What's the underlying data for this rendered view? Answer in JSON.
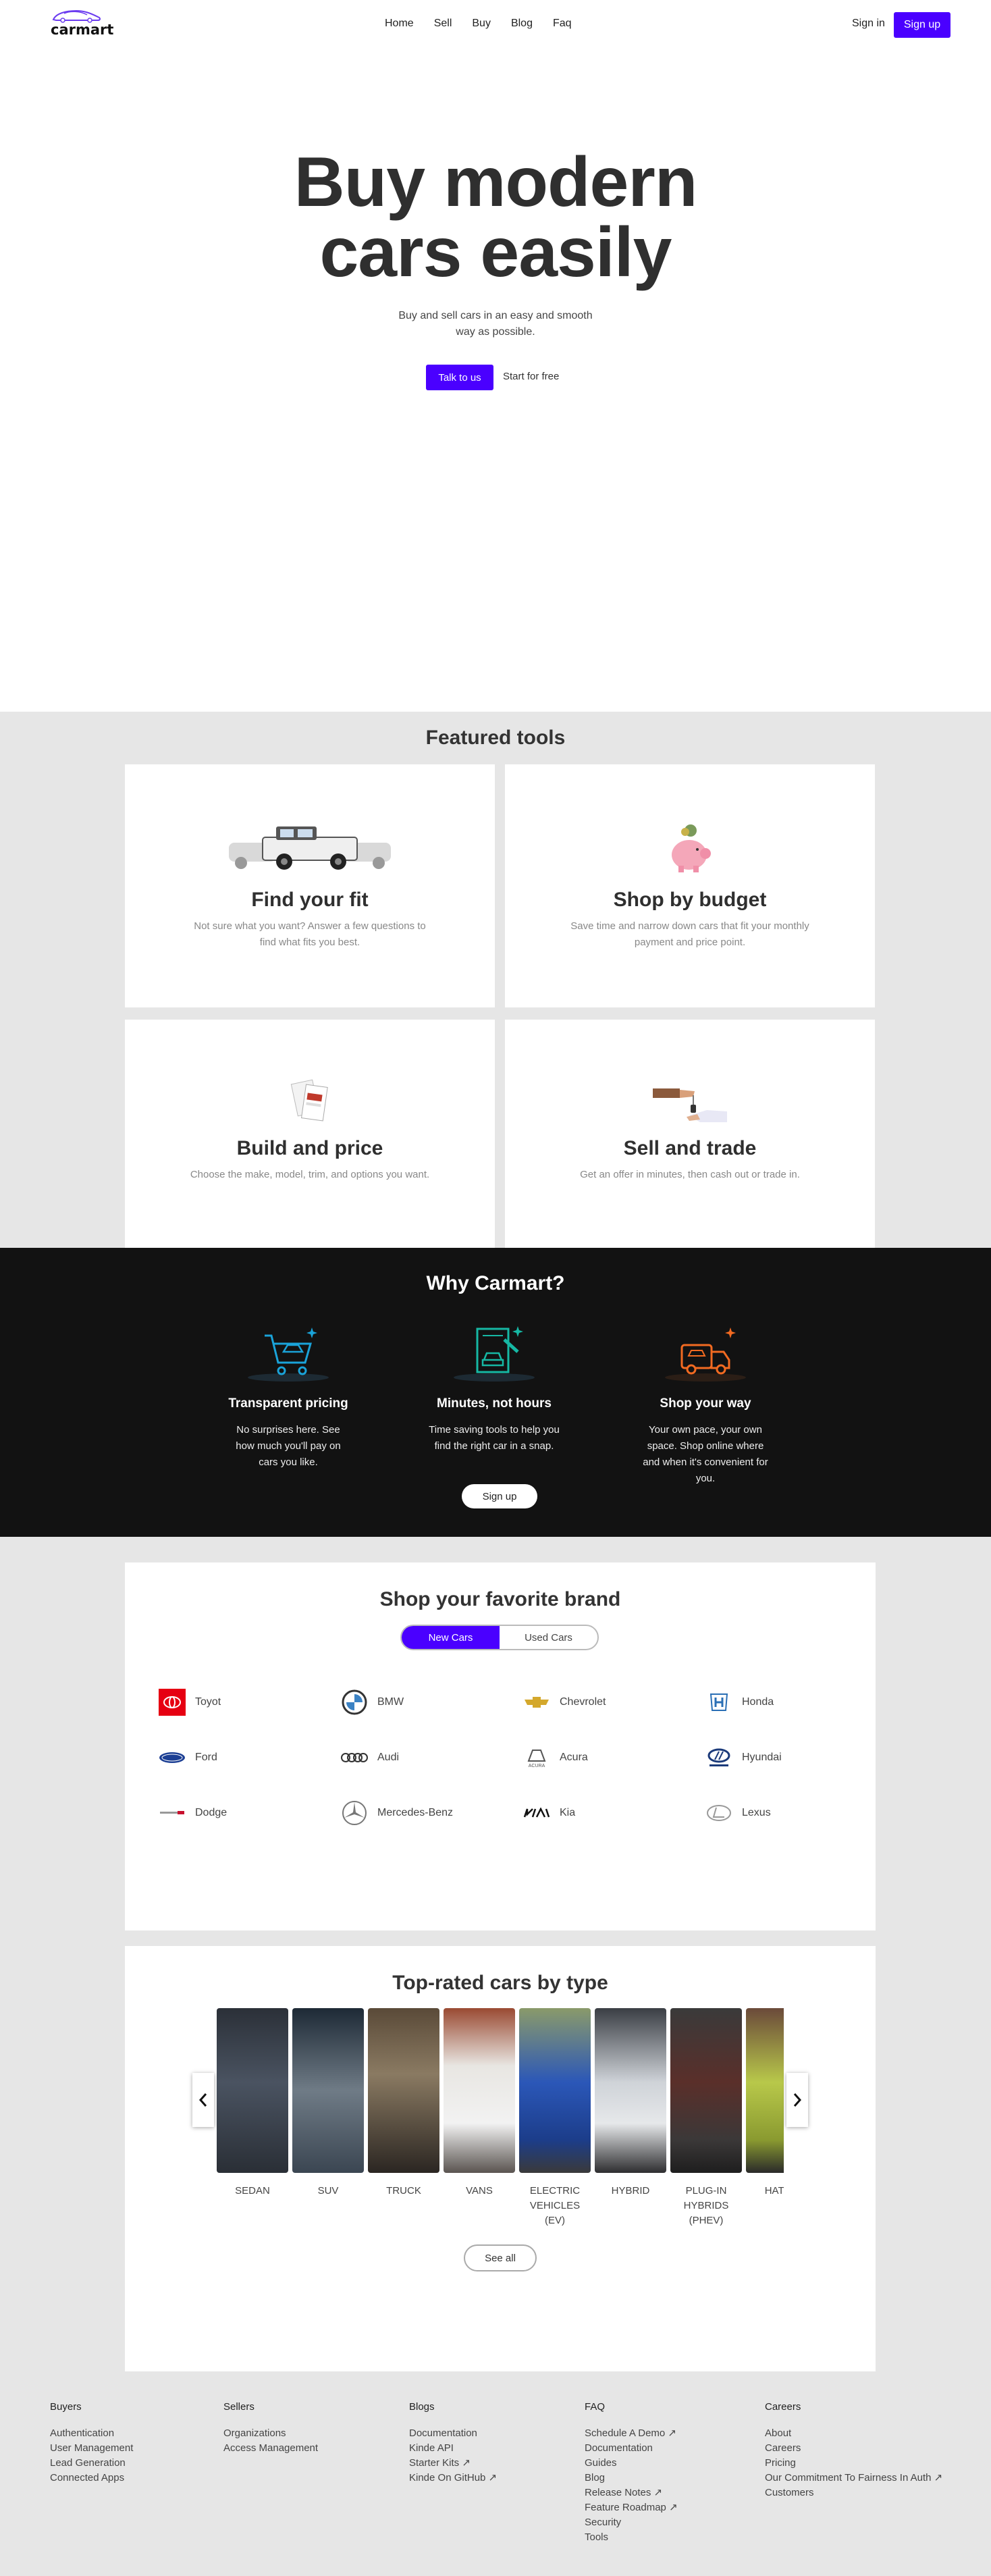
{
  "nav": {
    "brand": "carmart",
    "links": [
      "Home",
      "Sell",
      "Buy",
      "Blog",
      "Faq"
    ],
    "signin": "Sign in",
    "signup": "Sign up"
  },
  "hero": {
    "title_line1": "Buy modern",
    "title_line2": "cars easily",
    "subtitle": "Buy and sell cars in an easy and smooth way as possible.",
    "cta_primary": "Talk to us",
    "cta_secondary": "Start for free"
  },
  "featured": {
    "title": "Featured tools",
    "cards": [
      {
        "title": "Find your fit",
        "desc": "Not sure what you want? Answer a few questions to find what fits you best.",
        "image": "trucks-image"
      },
      {
        "title": "Shop by budget",
        "desc": "Save time and narrow down cars that fit your monthly payment and price point.",
        "image": "piggy-bank-image"
      },
      {
        "title": "Build and price",
        "desc": "Choose the make, model, trim, and options you want.",
        "image": "brochure-image"
      },
      {
        "title": "Sell and trade",
        "desc": "Get an offer in minutes, then cash out or trade in.",
        "image": "key-handover-image"
      }
    ]
  },
  "why": {
    "title": "Why Carmart?",
    "items": [
      {
        "title": "Transparent pricing",
        "desc": "No surprises here. See how much you'll pay on cars you like.",
        "icon": "cart-car-icon",
        "color": "#1aa3d9"
      },
      {
        "title": "Minutes, not hours",
        "desc": "Time saving tools to help you find the right car in a snap.",
        "icon": "document-car-icon",
        "color": "#16b8a4"
      },
      {
        "title": "Shop your way",
        "desc": "Your own pace, your own space. Shop online where and when it's convenient for you.",
        "icon": "delivery-truck-icon",
        "color": "#f26a21"
      }
    ],
    "signup": "Sign up"
  },
  "brands": {
    "title": "Shop your favorite brand",
    "tab_new": "New Cars",
    "tab_used": "Used Cars",
    "list": [
      "Toyot",
      "BMW",
      "Chevrolet",
      "Honda",
      "Ford",
      "Audi",
      "Acura",
      "Hyundai",
      "Dodge",
      "Mercedes-Benz",
      "Kia",
      "Lexus"
    ]
  },
  "types": {
    "title": "Top-rated cars by type",
    "items": [
      "SEDAN",
      "SUV",
      "TRUCK",
      "VANS",
      "ELECTRIC VEHICLES (EV)",
      "HYBRID",
      "PLUG-IN HYBRIDS (PHEV)",
      "HATCH"
    ],
    "see_all": "See all"
  },
  "footer": {
    "columns": [
      {
        "title": "Buyers",
        "links": [
          "Authentication",
          "User Management",
          "Lead Generation",
          "Connected Apps"
        ]
      },
      {
        "title": "Sellers",
        "links": [
          "Organizations",
          "Access Management"
        ]
      },
      {
        "title": "Blogs",
        "links": [
          "Documentation",
          "Kinde API",
          "Starter Kits ↗",
          "Kinde On GitHub ↗"
        ]
      },
      {
        "title": "FAQ",
        "links": [
          "Schedule A Demo ↗",
          "Documentation",
          "Guides",
          "Blog",
          "Release Notes ↗",
          "Feature Roadmap ↗",
          "Security",
          "Tools"
        ]
      },
      {
        "title": "Careers",
        "links": [
          "About",
          "Careers",
          "Pricing",
          "Our Commitment To Fairness In Auth ↗",
          "Customers"
        ]
      }
    ]
  }
}
